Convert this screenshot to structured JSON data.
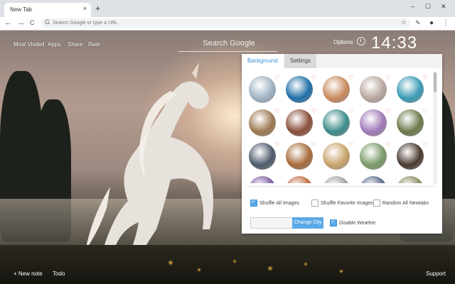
{
  "browser": {
    "tab_title": "New Tab",
    "tab_close": "×",
    "new_tab": "+",
    "win_min": "–",
    "win_max": "☐",
    "win_close": "✕",
    "omnibox_placeholder": "Search Google or type a URL",
    "nav_back": "←",
    "nav_forward": "→",
    "nav_reload": "C",
    "star": "☆",
    "menu": "⋮"
  },
  "ntp": {
    "links": [
      "Most Visited",
      "Apps",
      "Share",
      "Rate"
    ],
    "search_placeholder": "Search Google",
    "options_label": "Options",
    "clock": "14:33",
    "bottom_left": [
      "+ New note",
      "Todo"
    ],
    "bottom_right": "Support"
  },
  "panel": {
    "tabs": [
      "Background",
      "Settings"
    ],
    "active_tab": "Background",
    "thumb_colors": [
      "#9fb3c4",
      "#1f6fa8",
      "#c98a5e",
      "#b8a7a0",
      "#3a9ab5",
      "#9c7a52",
      "#8a4f3a",
      "#3d8c8a",
      "#9f7ab8",
      "#6b7a4d",
      "#4d5a6a",
      "#a86b3a",
      "#c9a36b",
      "#7a9a6a",
      "#4a3a30",
      "#7a5aa0",
      "#c06a40",
      "#a0a0a0",
      "#5a6a8a",
      "#8a8a60"
    ],
    "heart": "♡",
    "shuffle_all": "Shuffle All Images",
    "shuffle_fav": "Shuffle Favorite Images",
    "random_all": "Random All Newtabs",
    "shuffle_all_checked": true,
    "change_city": "Change City",
    "disable_weather": "Disable Weather",
    "disable_weather_checked": true
  }
}
